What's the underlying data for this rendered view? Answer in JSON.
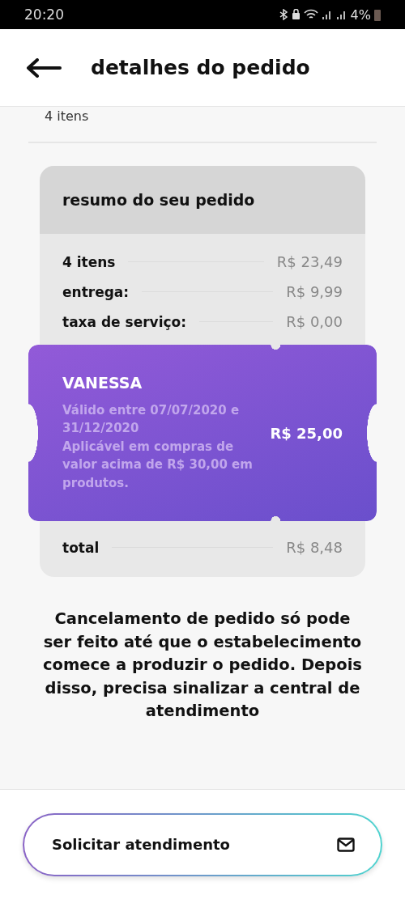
{
  "status_bar": {
    "time": "20:20",
    "battery": "4%"
  },
  "header": {
    "title": "detalhes do pedido"
  },
  "partial_line": "4 itens",
  "summary": {
    "title": "resumo do seu pedido",
    "rows": [
      {
        "label": "4 itens",
        "value": "R$ 23,49"
      },
      {
        "label": "entrega:",
        "value": "R$ 9,99"
      },
      {
        "label": "taxa de serviço:",
        "value": "R$ 0,00"
      }
    ],
    "coupon": {
      "name": "VANESSA",
      "details": [
        "Válido entre 07/07/2020 e 31/12/2020",
        "Aplicável em compras de valor acima de R$ 30,00 em produtos."
      ],
      "value": "R$ 25,00"
    },
    "total": {
      "label": "total",
      "value": "R$ 8,48"
    }
  },
  "notice": "Cancelamento de pedido só pode ser feito até que o estabelecimento comece a produzir o pedido. Depois disso, precisa sinalizar a central de atendimento",
  "button": {
    "label": "Solicitar atendimento"
  }
}
